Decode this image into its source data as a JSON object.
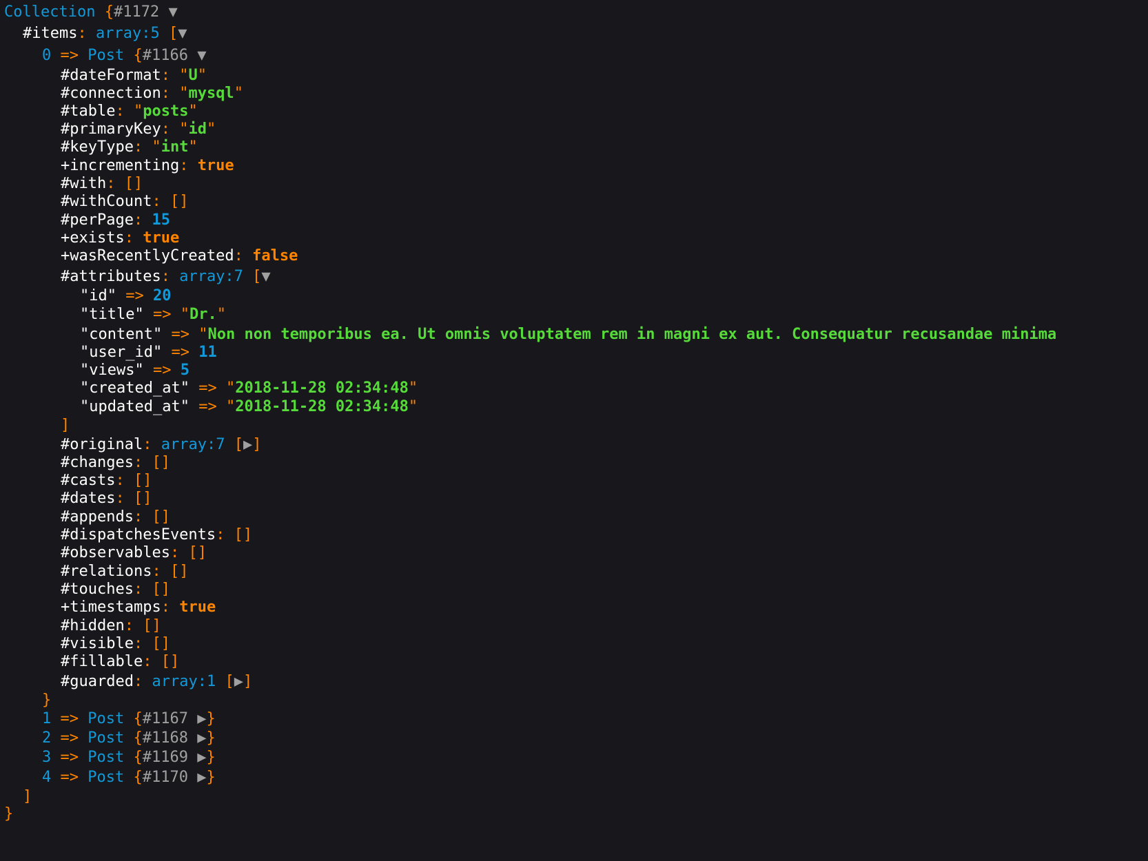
{
  "root": {
    "class": "Collection",
    "id": "#1172"
  },
  "items_key": "#items",
  "items_type": "array:5",
  "item0": {
    "index": "0",
    "class": "Post",
    "id": "#1166"
  },
  "props": {
    "dateFormat": {
      "name": "#dateFormat",
      "value": "U"
    },
    "connection": {
      "name": "#connection",
      "value": "mysql"
    },
    "table": {
      "name": "#table",
      "value": "posts"
    },
    "primaryKey": {
      "name": "#primaryKey",
      "value": "id"
    },
    "keyType": {
      "name": "#keyType",
      "value": "int"
    },
    "incrementing": {
      "name": "+incrementing",
      "value": "true"
    },
    "with": {
      "name": "#with"
    },
    "withCount": {
      "name": "#withCount"
    },
    "perPage": {
      "name": "#perPage",
      "value": "15"
    },
    "exists": {
      "name": "+exists",
      "value": "true"
    },
    "wasRecentlyCreated": {
      "name": "+wasRecentlyCreated",
      "value": "false"
    },
    "attributes": {
      "name": "#attributes",
      "type": "array:7"
    },
    "original": {
      "name": "#original",
      "type": "array:7"
    },
    "changes": {
      "name": "#changes"
    },
    "casts": {
      "name": "#casts"
    },
    "dates": {
      "name": "#dates"
    },
    "appends": {
      "name": "#appends"
    },
    "dispatchesEvents": {
      "name": "#dispatchesEvents"
    },
    "observables": {
      "name": "#observables"
    },
    "relations": {
      "name": "#relations"
    },
    "touches": {
      "name": "#touches"
    },
    "timestamps": {
      "name": "+timestamps",
      "value": "true"
    },
    "hidden": {
      "name": "#hidden"
    },
    "visible": {
      "name": "#visible"
    },
    "fillable": {
      "name": "#fillable"
    },
    "guarded": {
      "name": "#guarded",
      "type": "array:1"
    }
  },
  "attributes": {
    "id": {
      "key": "\"id\"",
      "value": "20"
    },
    "title": {
      "key": "\"title\"",
      "value": "Dr."
    },
    "content": {
      "key": "\"content\"",
      "value": "Non non temporibus ea. Ut omnis voluptatem rem in magni ex aut. Consequatur recusandae minima"
    },
    "user_id": {
      "key": "\"user_id\"",
      "value": "11"
    },
    "views": {
      "key": "\"views\"",
      "value": "5"
    },
    "created_at": {
      "key": "\"created_at\"",
      "value": "2018-11-28 02:34:48"
    },
    "updated_at": {
      "key": "\"updated_at\"",
      "value": "2018-11-28 02:34:48"
    }
  },
  "collapsed_items": [
    {
      "index": "1",
      "class": "Post",
      "id": "#1167"
    },
    {
      "index": "2",
      "class": "Post",
      "id": "#1168"
    },
    {
      "index": "3",
      "class": "Post",
      "id": "#1169"
    },
    {
      "index": "4",
      "class": "Post",
      "id": "#1170"
    }
  ],
  "glyphs": {
    "expanded": "▼",
    "collapsed": "▶",
    "arrow": "=>"
  },
  "colors": {
    "background": "#18171b",
    "key": "#ffffff",
    "punctuation": "#ff8400",
    "class": "#1299da",
    "string": "#56db3a",
    "number": "#1299da",
    "constant": "#ff8400",
    "object_id": "#a0a0a0"
  }
}
